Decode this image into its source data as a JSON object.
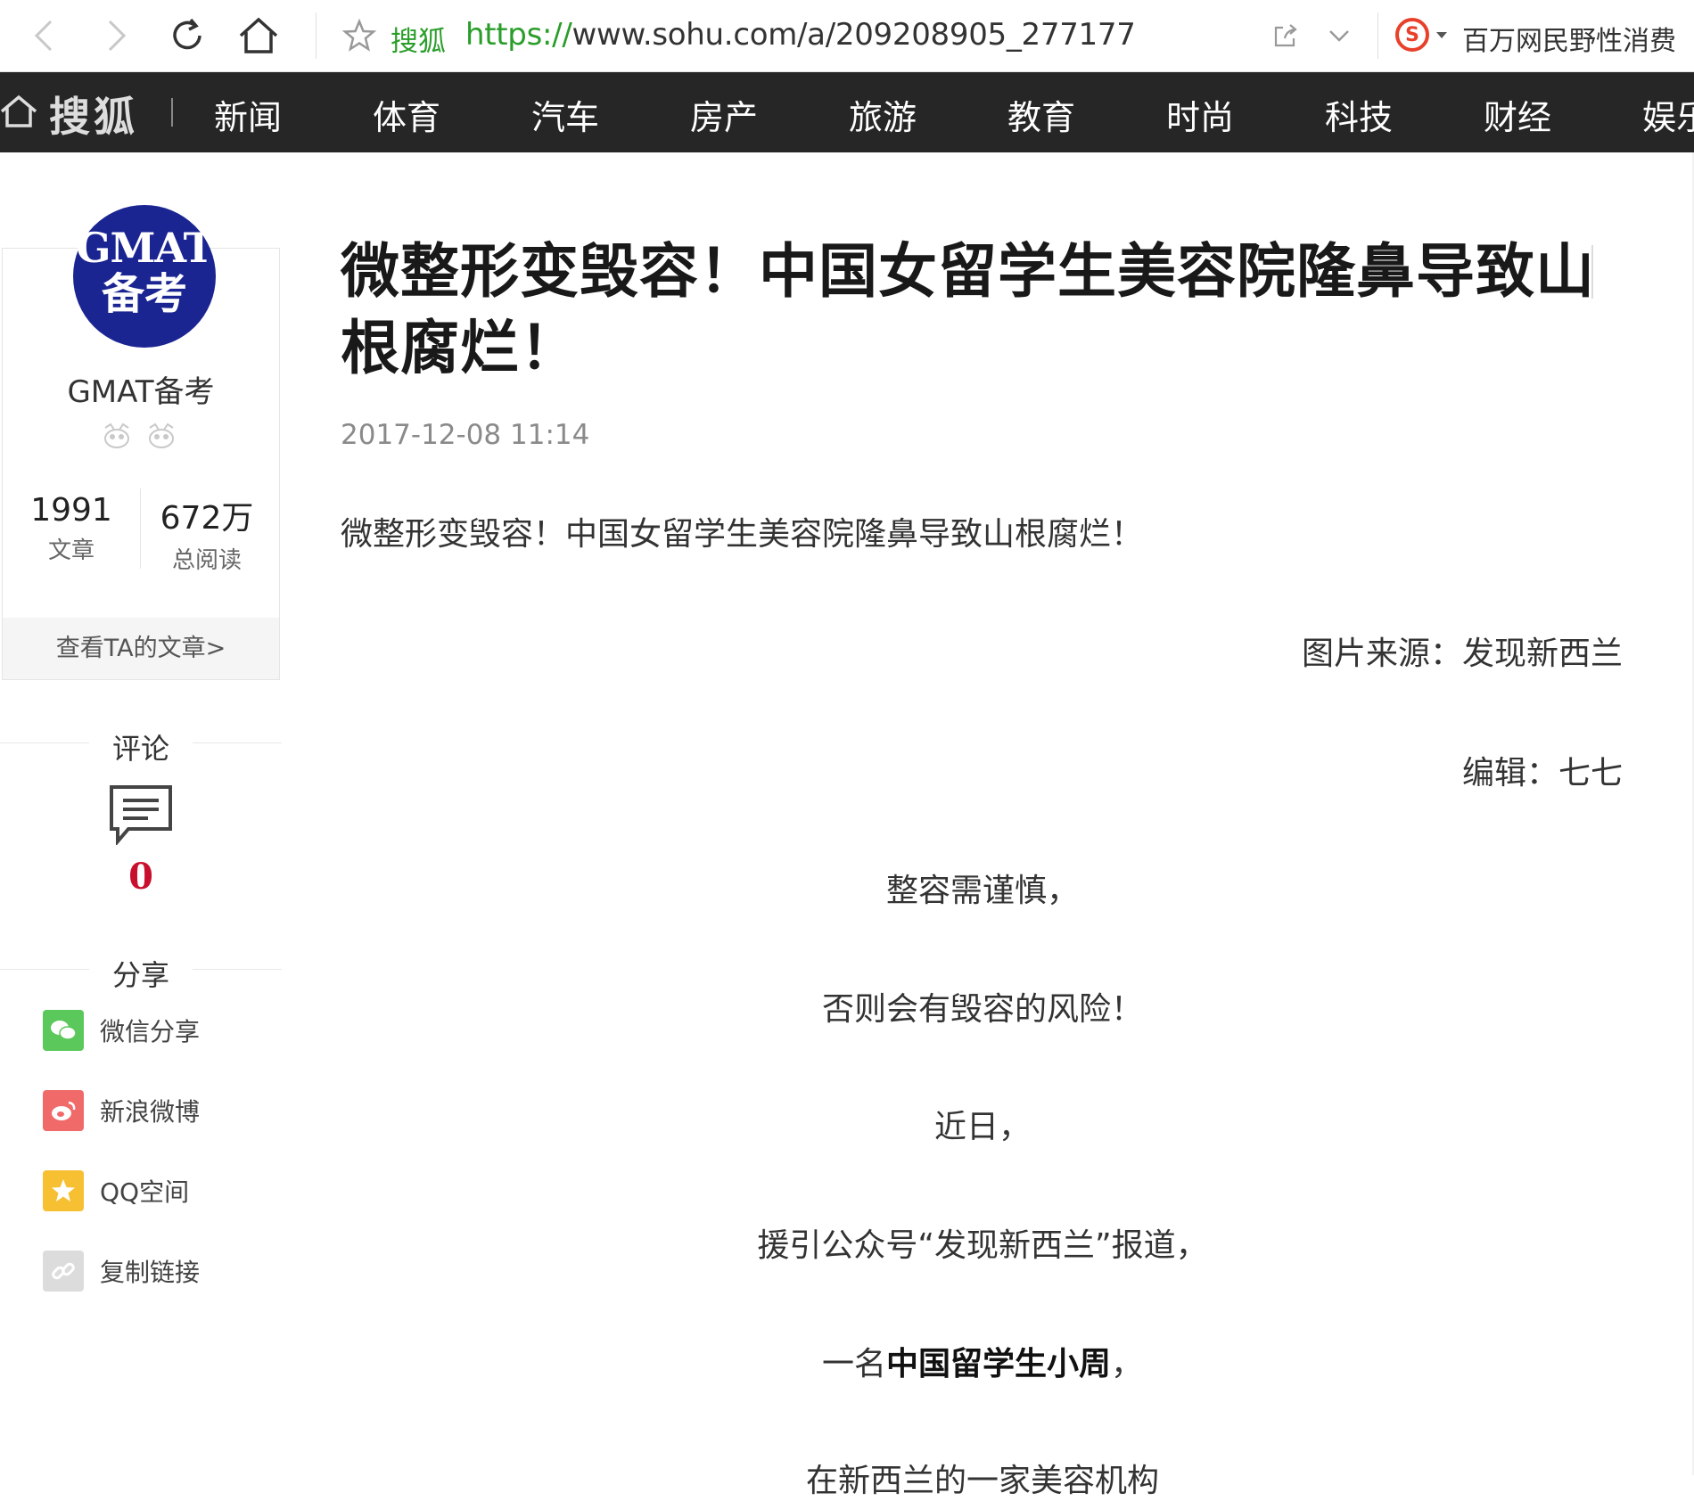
{
  "browser": {
    "site_name": "搜狐",
    "url_protocol": "https://",
    "url_rest": "www.sohu.com/a/209208905_277177",
    "hot_search": "百万网民野性消费",
    "icons": [
      "back-icon",
      "forward-icon",
      "refresh-icon",
      "home-icon",
      "star-icon",
      "share-out-icon",
      "chevron-down-icon",
      "sogou-icon"
    ]
  },
  "nav": {
    "logo": "搜狐",
    "items": [
      "新闻",
      "体育",
      "汽车",
      "房产",
      "旅游",
      "教育",
      "时尚",
      "科技",
      "财经",
      "娱乐"
    ]
  },
  "author": {
    "avatar_line1": "GMAT",
    "avatar_line2": "备考",
    "name": "GMAT备考",
    "articles_count": "1991",
    "articles_label": "文章",
    "reads_count": "672万",
    "reads_label": "总阅读",
    "view_articles": "查看TA的文章>"
  },
  "comments": {
    "heading": "评论",
    "count": "0"
  },
  "share": {
    "heading": "分享",
    "items": [
      {
        "label": "微信分享",
        "color": "#5ac85a",
        "icon": "wechat-icon"
      },
      {
        "label": "新浪微博",
        "color": "#f06a6a",
        "icon": "weibo-icon"
      },
      {
        "label": "QQ空间",
        "color": "#f7c033",
        "icon": "qzone-star-icon"
      },
      {
        "label": "复制链接",
        "color": "#dcdcdc",
        "icon": "link-icon"
      }
    ]
  },
  "article": {
    "title": "微整形变毁容！中国女留学生美容院隆鼻导致山根腐烂！",
    "time": "2017-12-08 11:14",
    "lead": "微整形变毁容！中国女留学生美容院隆鼻导致山根腐烂！",
    "image_source": "图片来源：发现新西兰",
    "editor": "编辑：七七",
    "lines": [
      "整容需谨慎，",
      "否则会有毁容的风险！",
      "近日，",
      "援引公众号“发现新西兰”报道，"
    ],
    "line5_prefix": "一名",
    "line5_bold": "中国留学生小周",
    "line5_suffix": "，",
    "line6": "在新西兰的一家美容机构"
  }
}
